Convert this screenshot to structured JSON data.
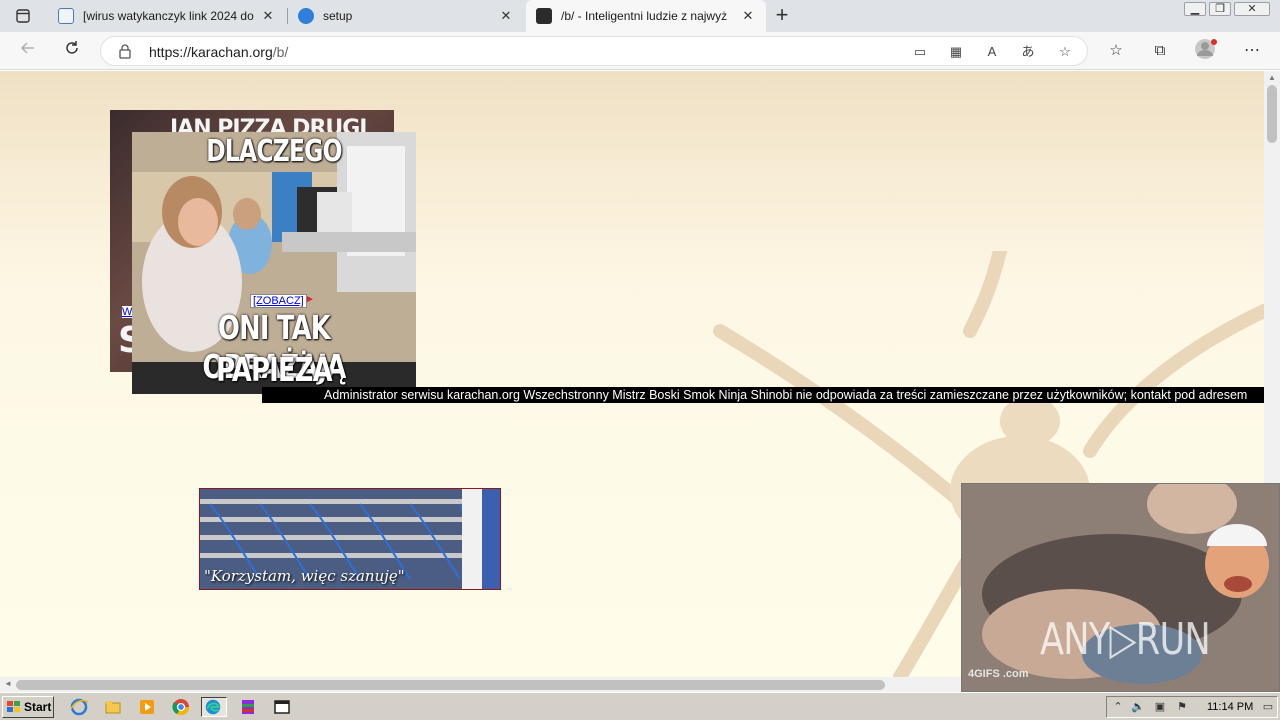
{
  "browser": {
    "tabs": [
      {
        "title": "[wirus watykanczyk link 2024 do",
        "active": false
      },
      {
        "title": "setup",
        "active": false
      },
      {
        "title": "/b/ - Inteligentni ludzie z najwyż",
        "active": true
      }
    ],
    "tab_close_glyph": "✕",
    "new_tab_glyph": "+",
    "url_host": "https://karachan.org",
    "url_path": "/b/",
    "window_controls": {
      "minimize": "▁",
      "restore": "❐",
      "close": "✕"
    }
  },
  "page": {
    "banner1": {
      "top_text": "JAN PIZZA DRUGI",
      "bottom_text": "S",
      "link_text": "W"
    },
    "banner2": {
      "top_text": "DLACZEGO",
      "bottom_line1": "ONI TAK OBRAŻAJĄ",
      "bottom_line2": "PAPIEŻA",
      "link_text": "[ZOBACZ]",
      "arrow": "►"
    },
    "ticker_text": "Administrator serwisu karachan.org Wszechstronny Mistrz Boski Smok Ninja Shinobi nie odpowiada za treści zamieszczane przez użytkowników; kontakt pod adresem",
    "servers_caption": "\"Korzystam, więc szanuję\"",
    "overlay": {
      "watermark": "ANY▷RUN",
      "gif_label": "4GIFS .com"
    }
  },
  "taskbar": {
    "start_label": "Start",
    "clock": "11:14 PM"
  }
}
